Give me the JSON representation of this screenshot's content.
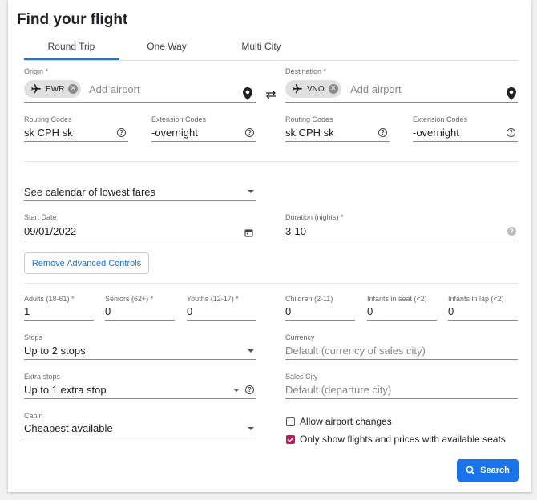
{
  "title": "Find your flight",
  "tabs": [
    {
      "label": "Round Trip",
      "active": true
    },
    {
      "label": "One Way",
      "active": false
    },
    {
      "label": "Multi City",
      "active": false
    }
  ],
  "origin": {
    "label": "Origin *",
    "chip": "EWR",
    "placeholder": "Add airport"
  },
  "destination": {
    "label": "Destination *",
    "chip": "VNO",
    "placeholder": "Add airport"
  },
  "codes": {
    "origin_routing": {
      "label": "Routing Codes",
      "value": "sk CPH sk"
    },
    "origin_extension": {
      "label": "Extension Codes",
      "value": "-overnight"
    },
    "dest_routing": {
      "label": "Routing Codes",
      "value": "sk CPH sk"
    },
    "dest_extension": {
      "label": "Extension Codes",
      "value": "-overnight"
    }
  },
  "calendar_select": "See calendar of lowest fares",
  "start_date": {
    "label": "Start Date",
    "value": "09/01/2022"
  },
  "duration": {
    "label": "Duration (nights) *",
    "value": "3-10"
  },
  "advanced_button": "Remove Advanced Controls",
  "passengers": [
    {
      "label": "Adults (18-61) *",
      "value": "1"
    },
    {
      "label": "Seniors (62+) *",
      "value": "0"
    },
    {
      "label": "Youths (12-17) *",
      "value": "0"
    },
    {
      "label": "Children (2-11)",
      "value": "0"
    },
    {
      "label": "Infants in seat (<2)",
      "value": "0"
    },
    {
      "label": "Infants in lap (<2)",
      "value": "0"
    }
  ],
  "stops": {
    "label": "Stops",
    "value": "Up to 2 stops"
  },
  "extra_stops": {
    "label": "Extra stops",
    "value": "Up to 1 extra stop"
  },
  "cabin": {
    "label": "Cabin",
    "value": "Cheapest available"
  },
  "currency": {
    "label": "Currency",
    "placeholder": "Default (currency of sales city)"
  },
  "sales_city": {
    "label": "Sales City",
    "placeholder": "Default (departure city)"
  },
  "checkboxes": {
    "airport_changes": {
      "label": "Allow airport changes",
      "checked": false
    },
    "available_seats": {
      "label": "Only show flights and prices with available seats",
      "checked": true
    }
  },
  "search_button": "Search",
  "colors": {
    "primary": "#1a73e8",
    "checkbox_accent": "#c2185b"
  }
}
